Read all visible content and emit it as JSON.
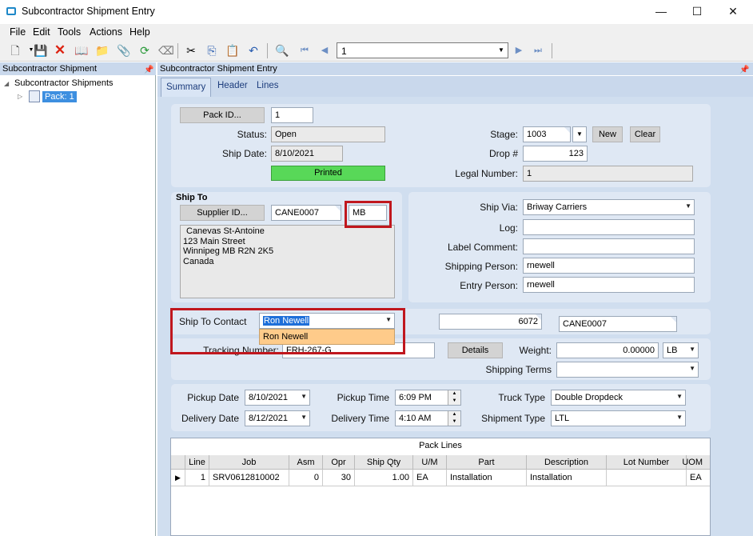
{
  "window": {
    "title": "Subcontractor Shipment Entry"
  },
  "menu": [
    "File",
    "Edit",
    "Tools",
    "Actions",
    "Help"
  ],
  "toolbar": {
    "record_value": "1"
  },
  "tree_pane": {
    "header": "Subcontractor Shipment",
    "root": "Subcontractor Shipments",
    "child": "Pack: 1"
  },
  "main_pane": {
    "header": "Subcontractor Shipment Entry"
  },
  "tabs": [
    "Summary",
    "Header",
    "Lines"
  ],
  "summary": {
    "pack_id_button": "Pack ID...",
    "pack_id": "1",
    "status_label": "Status:",
    "status": "Open",
    "ship_date_label": "Ship Date:",
    "ship_date": "8/10/2021",
    "printed_badge": "Printed",
    "stage_label": "Stage:",
    "stage": "1003",
    "new_button": "New",
    "clear_button": "Clear",
    "drop_label": "Drop #",
    "drop": "123",
    "legal_label": "Legal Number:",
    "legal": "1"
  },
  "ship_to": {
    "header": "Ship To",
    "supplier_button": "Supplier ID...",
    "supplier_id": "CANE0007",
    "suffix": "MB",
    "address": [
      "Canevas St-Antoine",
      "123 Main Street",
      "Winnipeg MB R2N 2K5",
      "Canada"
    ]
  },
  "ship_info": {
    "ship_via_label": "Ship Via:",
    "ship_via": "Briway Carriers",
    "log_label": "Log:",
    "log": "",
    "label_comment_label": "Label Comment:",
    "label_comment": "",
    "shipping_person_label": "Shipping Person:",
    "shipping_person": "rnewell",
    "entry_person_label": "Entry Person:",
    "entry_person": "rnewell"
  },
  "contact": {
    "label": "Ship To Contact",
    "value": "Ron Newell",
    "dropdown_option": "Ron Newell",
    "number": "6072",
    "code": "CANE0007"
  },
  "tracking": {
    "label": "Tracking Number:",
    "value": "FRH-267-G",
    "details_button": "Details",
    "weight_label": "Weight:",
    "weight": "0.00000",
    "weight_unit": "LB",
    "terms_label": "Shipping Terms",
    "terms": ""
  },
  "dates": {
    "pickup_date_label": "Pickup Date",
    "pickup_date": "8/10/2021",
    "delivery_date_label": "Delivery Date",
    "delivery_date": "8/12/2021",
    "pickup_time_label": "Pickup Time",
    "pickup_time": "6:09 PM",
    "delivery_time_label": "Delivery Time",
    "delivery_time": "4:10 AM",
    "truck_type_label": "Truck Type",
    "truck_type": "Double Dropdeck",
    "shipment_type_label": "Shipment Type",
    "shipment_type": "LTL"
  },
  "pack_lines": {
    "title": "Pack Lines",
    "columns": [
      "Line",
      "Job",
      "Asm",
      "Opr",
      "Ship Qty",
      "U/M",
      "Part",
      "Description",
      "Lot Number",
      "UOM"
    ],
    "rows": [
      [
        "1",
        "SRV0612810002",
        "0",
        "30",
        "1.00",
        "EA",
        "Installation",
        "Installation",
        "",
        "EA"
      ]
    ]
  }
}
